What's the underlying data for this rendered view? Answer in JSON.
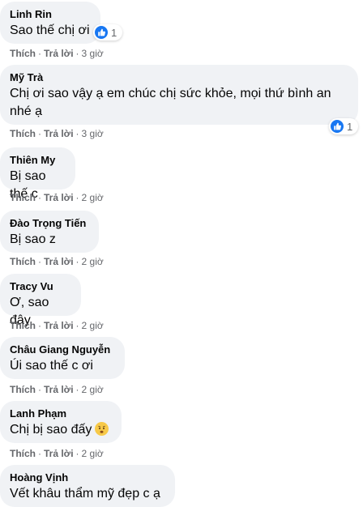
{
  "actions": {
    "like": "Thích",
    "reply": "Trả lời",
    "separator": "·"
  },
  "comments": [
    {
      "author": "Linh Rin",
      "text": "Sao thế chị ơi",
      "time": "3 giờ",
      "reactions": "1"
    },
    {
      "author": "Mỹ Trà",
      "text": "Chị ơi sao vậy ạ em chúc chị sức khỏe, mọi thứ bình an nhé ạ",
      "time": "3 giờ",
      "reactions": "1"
    },
    {
      "author": "Thiên My",
      "text": "Bị sao thế c",
      "time": "2 giờ"
    },
    {
      "author": "Đào Trọng Tiến",
      "text": "Bị sao z",
      "time": "2 giờ"
    },
    {
      "author": "Tracy Vu",
      "text": "Ơ, sao đây",
      "time": "2 giờ"
    },
    {
      "author": "Châu Giang Nguyễn",
      "text": "Úi sao thế c ơi",
      "time": "2 giờ"
    },
    {
      "author": "Lanh Phạm",
      "text": "Chị bị sao đấy",
      "time": "2 giờ",
      "emoji": "worried-face-emoji"
    },
    {
      "author": "Hoàng Vịnh",
      "text": "Vết khâu thẩm mỹ đẹp c ạ"
    }
  ],
  "colors": {
    "bubble": "#f0f2f5",
    "like_blue": "#1877f2",
    "meta_gray": "#65676b"
  }
}
